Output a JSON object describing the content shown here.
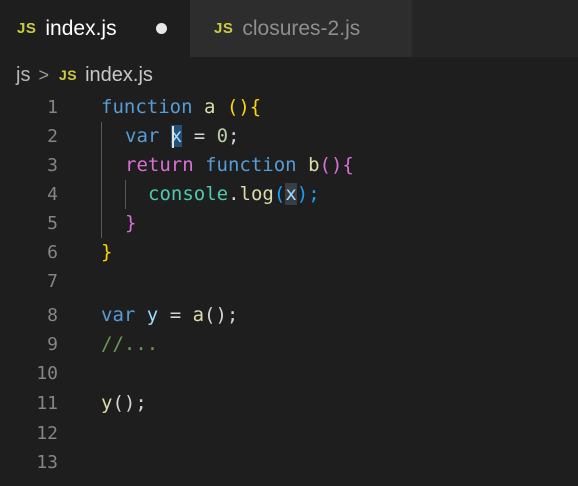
{
  "tabs": [
    {
      "badge": "JS",
      "label": "index.js",
      "dirty": true
    },
    {
      "badge": "JS",
      "label": "closures-2.js"
    }
  ],
  "breadcrumb": {
    "folder": "js",
    "separator": ">",
    "badge": "JS",
    "file": "index.js"
  },
  "editor": {
    "line_numbers": [
      "1",
      "2",
      "3",
      "4",
      "5",
      "6",
      "7",
      "8",
      "9",
      "10",
      "11",
      "12",
      "13"
    ],
    "tokens": {
      "l1": [
        "function",
        "a",
        "(){"
      ],
      "l2": [
        "var",
        "x",
        "=",
        "0",
        ";"
      ],
      "l3": [
        "return",
        "function",
        "b",
        "(){"
      ],
      "l4": [
        "console",
        ".",
        "log",
        "(",
        "x",
        ");"
      ],
      "l5": [
        "}"
      ],
      "l6": [
        "}"
      ],
      "l8": [
        "var",
        "y",
        "=",
        "a",
        "();"
      ],
      "l9": [
        "//..."
      ],
      "l11": [
        "y",
        "();"
      ]
    }
  },
  "colors": {
    "keyword": "#569cd6",
    "function": "#dcdcaa",
    "variable": "#9cdcfe",
    "number": "#b5cea8",
    "comment": "#6a9955",
    "js_badge": "#cbcb41"
  }
}
